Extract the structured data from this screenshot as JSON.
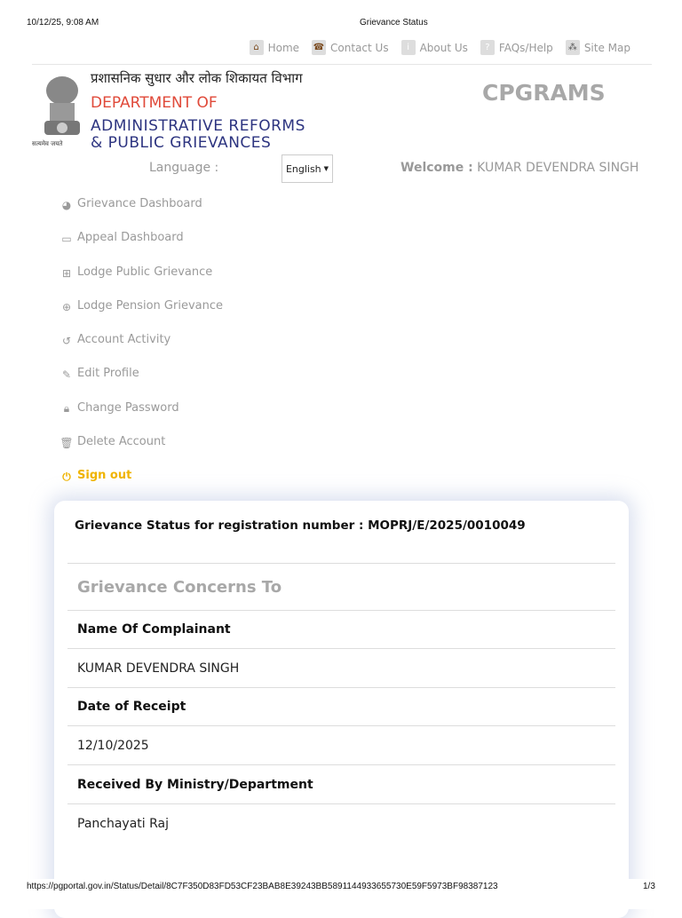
{
  "print": {
    "datetime": "10/12/25, 9:08 AM",
    "title": "Grievance Status",
    "url": "https://pgportal.gov.in/Status/Detail/8C7F350D83FD53CF23BAB8E39243BB5891144933655730E59F5973BF98387123",
    "page": "1/3"
  },
  "topnav": [
    {
      "label": "Home",
      "icon": "home-icon"
    },
    {
      "label": "Contact Us",
      "icon": "phone-icon"
    },
    {
      "label": "About Us",
      "icon": "info-icon"
    },
    {
      "label": "FAQs/Help",
      "icon": "help-icon"
    },
    {
      "label": "Site Map",
      "icon": "sitemap-icon"
    }
  ],
  "header": {
    "hindi": "प्रशासनिक सुधार और लोक शिकायत विभाग",
    "line1": "DEPARTMENT OF",
    "line2": "ADMINISTRATIVE REFORMS",
    "line3": "& PUBLIC GRIEVANCES",
    "emblem_text": "सत्यमेव जयते",
    "app": "CPGRAMS"
  },
  "language": {
    "label": "Language :",
    "selected": "English"
  },
  "welcome": {
    "label": "Welcome :",
    "user": "KUMAR DEVENDRA SINGH"
  },
  "menu": [
    {
      "label": "Grievance Dashboard",
      "icon": "dashboard-icon"
    },
    {
      "label": "Appeal Dashboard",
      "icon": "monitor-icon"
    },
    {
      "label": "Lodge Public Grievance",
      "icon": "plus-square-icon"
    },
    {
      "label": "Lodge Pension Grievance",
      "icon": "plus-circle-icon"
    },
    {
      "label": "Account Activity",
      "icon": "history-icon"
    },
    {
      "label": "Edit Profile",
      "icon": "edit-icon"
    },
    {
      "label": "Change Password",
      "icon": "lock-icon"
    },
    {
      "label": "Delete Account",
      "icon": "trash-icon"
    },
    {
      "label": "Sign out",
      "icon": "power-icon"
    }
  ],
  "card": {
    "title": "Grievance Status for registration number : MOPRJ/E/2025/0010049",
    "section": "Grievance Concerns To",
    "fields": [
      {
        "label": "Name Of Complainant",
        "value": "KUMAR DEVENDRA SINGH"
      },
      {
        "label": "Date of Receipt",
        "value": "12/10/2025"
      },
      {
        "label": "Received By Ministry/Department",
        "value": "Panchayati Raj"
      }
    ]
  }
}
